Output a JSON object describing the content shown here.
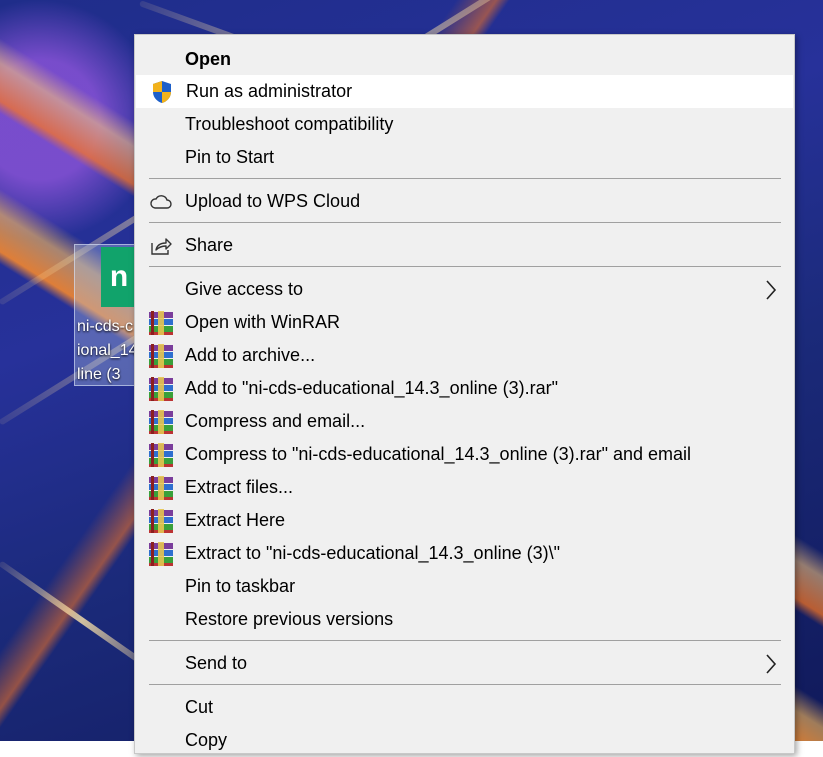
{
  "desktop": {
    "icon_caption": "ni-cds-c\nional_14\nline (3",
    "icon_glyph": "n"
  },
  "menu": {
    "items": [
      {
        "label": "Open",
        "bold": true,
        "icon": "none"
      },
      {
        "label": "Run as administrator",
        "icon": "uac-shield-icon",
        "highlighted": true
      },
      {
        "label": "Troubleshoot compatibility",
        "icon": "none"
      },
      {
        "label": "Pin to Start",
        "icon": "none"
      },
      {
        "label": "Upload to WPS Cloud",
        "icon": "cloud-icon"
      },
      {
        "label": "Share",
        "icon": "share-icon"
      },
      {
        "label": "Give access to",
        "icon": "none",
        "submenu": true
      },
      {
        "label": "Open with WinRAR",
        "icon": "winrar-icon"
      },
      {
        "label": "Add to archive...",
        "icon": "winrar-icon"
      },
      {
        "label": "Add to \"ni-cds-educational_14.3_online (3).rar\"",
        "icon": "winrar-icon"
      },
      {
        "label": "Compress and email...",
        "icon": "winrar-icon"
      },
      {
        "label": "Compress to \"ni-cds-educational_14.3_online (3).rar\" and email",
        "icon": "winrar-icon"
      },
      {
        "label": "Extract files...",
        "icon": "winrar-icon"
      },
      {
        "label": "Extract Here",
        "icon": "winrar-icon"
      },
      {
        "label": "Extract to \"ni-cds-educational_14.3_online (3)\\\"",
        "icon": "winrar-icon"
      },
      {
        "label": "Pin to taskbar",
        "icon": "none"
      },
      {
        "label": "Restore previous versions",
        "icon": "none"
      },
      {
        "label": "Send to",
        "icon": "none",
        "submenu": true
      },
      {
        "label": "Cut",
        "icon": "none"
      },
      {
        "label": "Copy",
        "icon": "none"
      }
    ]
  }
}
